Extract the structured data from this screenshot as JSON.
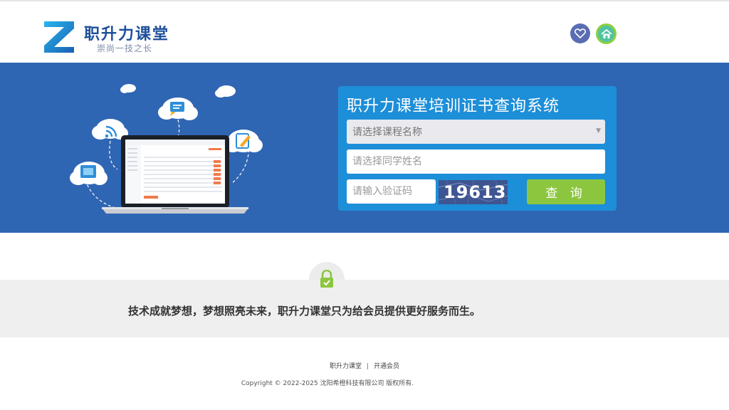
{
  "header": {
    "brand_name": "职升力课堂",
    "brand_slogan": "崇尚一技之长",
    "favorite_icon": "heart-icon",
    "home_icon": "home-icon"
  },
  "query": {
    "title": "职升力课堂培训证书查询系统",
    "course_placeholder": "请选择课程名称",
    "name_placeholder": "请选择同学姓名",
    "code_placeholder": "请输入验证码",
    "captcha": "19613",
    "submit_label": "查 询"
  },
  "mission": {
    "icon": "lock-check-icon",
    "text": "技术成就梦想，梦想照亮未来，职升力课堂只为给会员提供更好服务而生。"
  },
  "footer": {
    "link1": "职升力课堂",
    "separator": "|",
    "link2": "开通会员",
    "copyright": "Copyright © 2022-2025 沈阳希橙科技有限公司 版权所有."
  },
  "colors": {
    "banner": "#2f66b3",
    "panel": "#1d8ed8",
    "submit": "#8cc63f",
    "brand": "#1d4f9a"
  }
}
